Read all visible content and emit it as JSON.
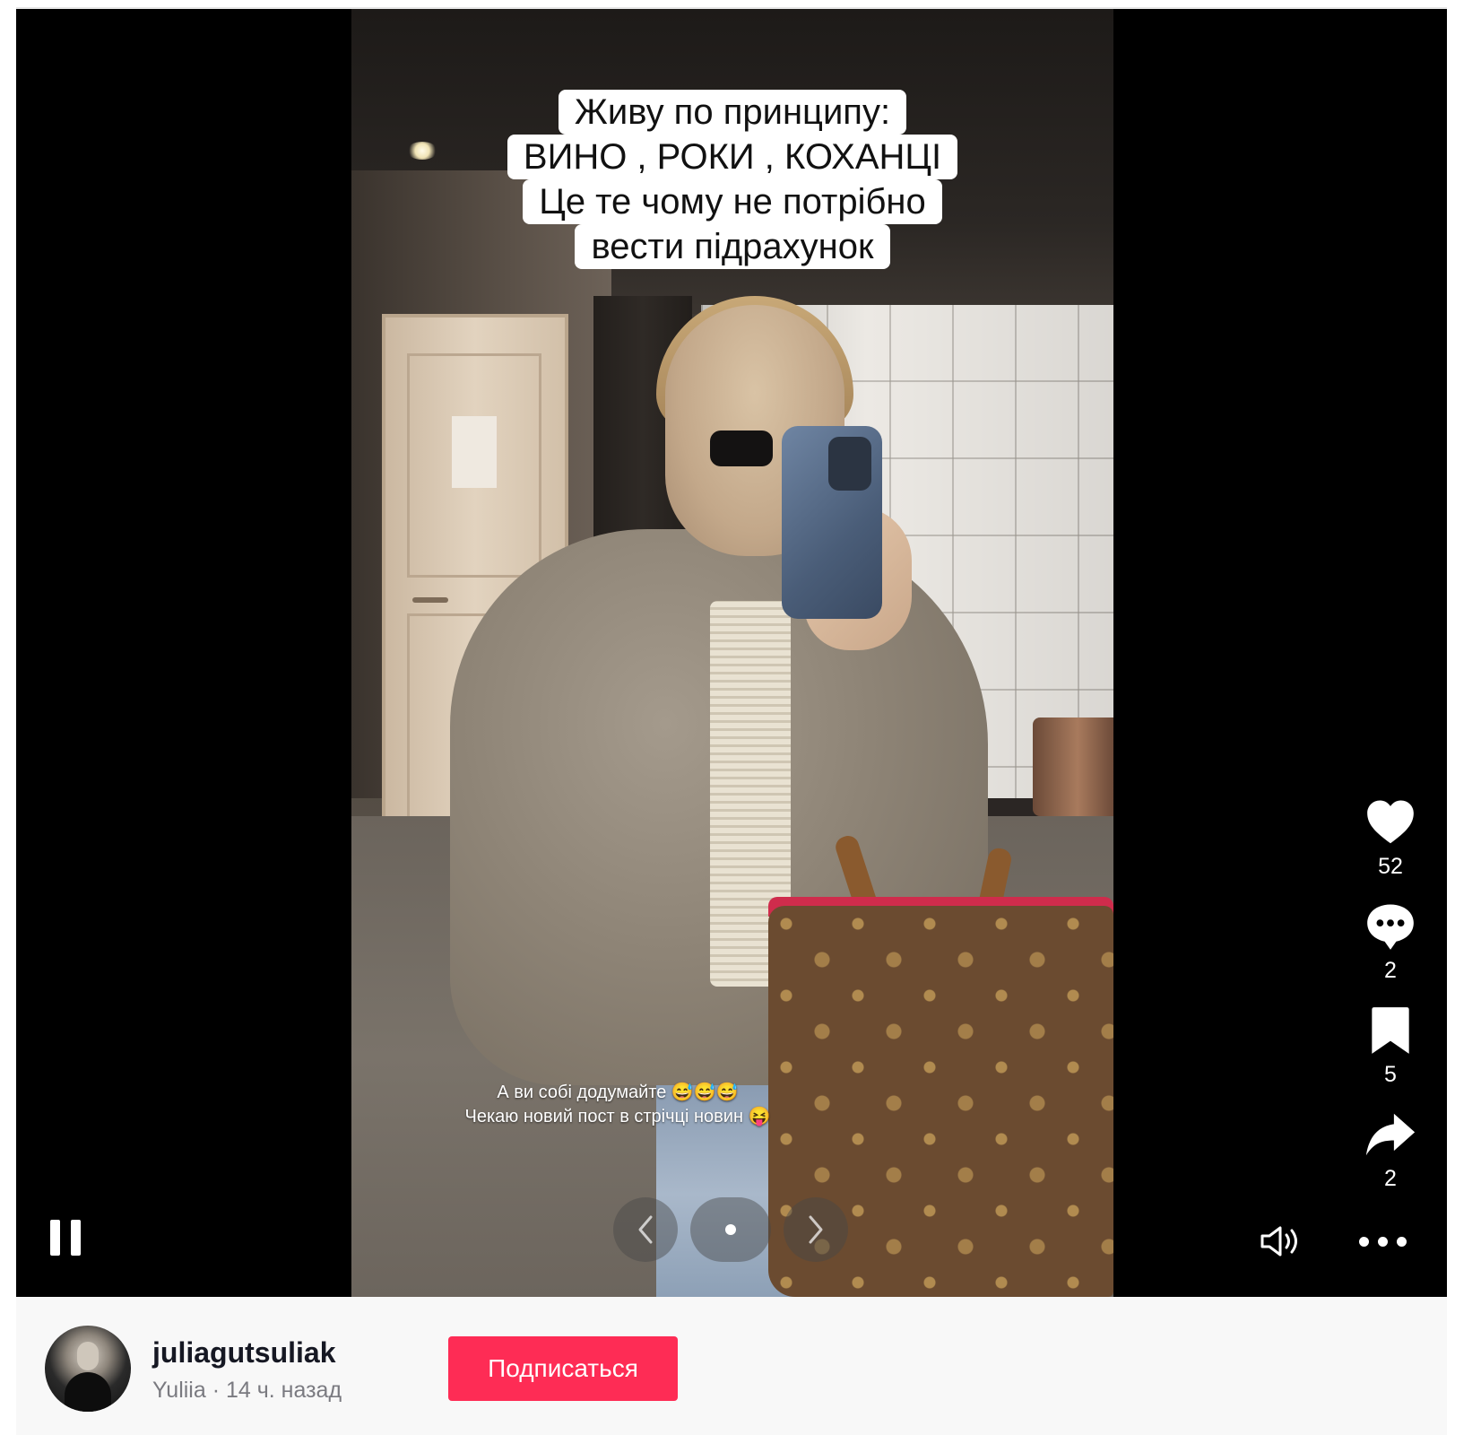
{
  "video": {
    "caption_lines": [
      "Живу по принципу:",
      "ВИНО , РОКИ , КОХАНЦІ",
      "Це те чому не потрібно",
      "вести підрахунок"
    ],
    "story_text_lines": [
      "А ви собі додумайте 😅😅😅",
      "Чекаю новий пост в стрічці новин 😝"
    ],
    "carousel": {
      "prev_label": "‹",
      "next_label": "›",
      "current_slide": 1,
      "total_slides": 1
    }
  },
  "actions": {
    "like": {
      "icon": "heart-icon",
      "count": "52"
    },
    "comment": {
      "icon": "comment-icon",
      "count": "2"
    },
    "save": {
      "icon": "bookmark-icon",
      "count": "5"
    },
    "share": {
      "icon": "share-icon",
      "count": "2"
    }
  },
  "controls": {
    "pause_icon": "pause-icon",
    "volume_icon": "volume-icon",
    "more_icon": "more-icon"
  },
  "author": {
    "username": "juliagutsuliak",
    "display_name_and_time": "Yuliia · 14 ч. назад",
    "follow_label": "Подписаться"
  },
  "colors": {
    "accent": "#fe2c55",
    "player_bg": "#000000",
    "footer_bg": "#f8f8f8"
  }
}
